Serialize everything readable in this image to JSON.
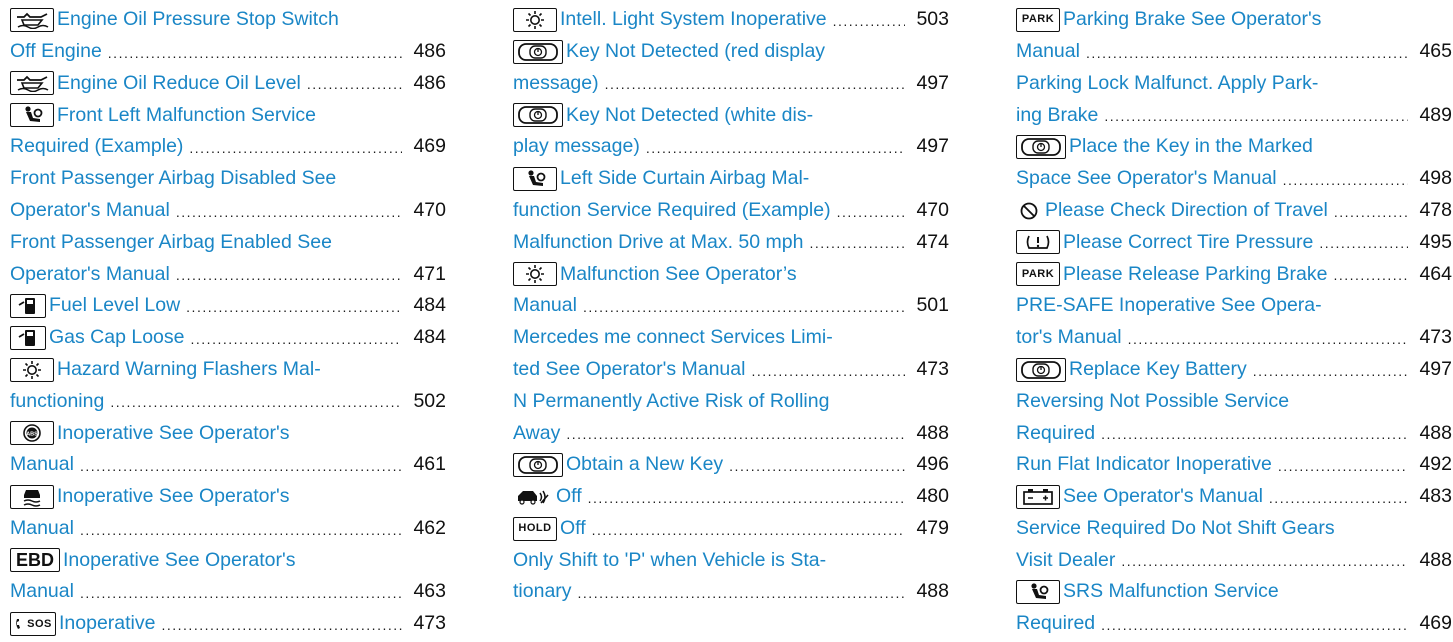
{
  "columns": [
    {
      "lines": [
        {
          "icon": "oil-level-icon",
          "title": "Engine Oil Pressure Stop Switch",
          "page": ""
        },
        {
          "icon": "",
          "title": "Off Engine",
          "page": "486"
        },
        {
          "icon": "oil-level-icon",
          "title": "Engine Oil Reduce Oil Level",
          "page": "486"
        },
        {
          "icon": "airbag-icon",
          "title": "Front Left Malfunction Service",
          "page": ""
        },
        {
          "icon": "",
          "title": "Required (Example)",
          "page": "469"
        },
        {
          "icon": "",
          "title": "Front Passenger Airbag Disabled See",
          "page": ""
        },
        {
          "icon": "",
          "title": "Operator's Manual",
          "page": "470"
        },
        {
          "icon": "",
          "title": "Front Passenger Airbag Enabled See",
          "page": ""
        },
        {
          "icon": "",
          "title": "Operator's Manual",
          "page": "471"
        },
        {
          "icon": "fuel-pump-icon",
          "title": "Fuel Level Low",
          "page": "484"
        },
        {
          "icon": "fuel-pump-icon",
          "title": "Gas Cap Loose",
          "page": "484"
        },
        {
          "icon": "light-bulb-icon",
          "title": " Hazard Warning Flashers Mal-",
          "page": ""
        },
        {
          "icon": "",
          "title": "functioning",
          "page": "502"
        },
        {
          "icon": "abs-icon",
          "title": "Inoperative See Operator's",
          "page": ""
        },
        {
          "icon": "",
          "title": "Manual",
          "page": "461"
        },
        {
          "icon": "stability-control-icon",
          "title": "Inoperative See Operator's",
          "page": ""
        },
        {
          "icon": "",
          "title": "Manual",
          "page": "462"
        },
        {
          "icon": "ebd-icon",
          "title": "Inoperative See Operator's",
          "page": ""
        },
        {
          "icon": "",
          "title": "Manual",
          "page": "463"
        },
        {
          "icon": "sos-icon",
          "title": "Inoperative",
          "page": "473"
        }
      ]
    },
    {
      "lines": [
        {
          "icon": "light-bulb-icon",
          "title": "Intell. Light System Inoperative",
          "page": "503"
        },
        {
          "icon": "key-icon",
          "title": "Key Not Detected  (red display",
          "page": ""
        },
        {
          "icon": "",
          "title": "message)",
          "page": "497"
        },
        {
          "icon": "key-icon",
          "title": "Key Not Detected  (white dis-",
          "page": ""
        },
        {
          "icon": "",
          "title": "play message)",
          "page": "497"
        },
        {
          "icon": "airbag-icon",
          "title": "Left Side Curtain Airbag Mal-",
          "page": ""
        },
        {
          "icon": "",
          "title": "function Service Required (Example)",
          "page": "470"
        },
        {
          "icon": "",
          "title": "Malfunction Drive at Max. 50 mph",
          "page": "474"
        },
        {
          "icon": "light-bulb-icon",
          "title": "Malfunction See Operator’s",
          "page": ""
        },
        {
          "icon": "",
          "title": "Manual",
          "page": "501"
        },
        {
          "icon": "",
          "title": "Mercedes me connect Services Limi-",
          "page": ""
        },
        {
          "icon": "",
          "title": "ted See Operator's Manual",
          "page": "473"
        },
        {
          "icon": "",
          "title": "N Permanently Active Risk of Rolling",
          "page": ""
        },
        {
          "icon": "",
          "title": "Away",
          "page": "488"
        },
        {
          "icon": "key-icon",
          "title": "Obtain a New Key",
          "page": "496"
        },
        {
          "icon": "vehicle-sensor-icon",
          "title": "Off",
          "page": "480"
        },
        {
          "icon": "hold-icon",
          "title": "Off",
          "page": "479"
        },
        {
          "icon": "",
          "title": "Only Shift to 'P' when Vehicle is Sta-",
          "page": ""
        },
        {
          "icon": "",
          "title": "tionary",
          "page": "488"
        }
      ]
    },
    {
      "lines": [
        {
          "icon": "park-icon",
          "title": "Parking Brake See Operator's",
          "page": ""
        },
        {
          "icon": "",
          "title": "Manual",
          "page": "465"
        },
        {
          "icon": "",
          "title": "Parking Lock Malfunct. Apply Park-",
          "page": ""
        },
        {
          "icon": "",
          "title": "ing Brake",
          "page": "489"
        },
        {
          "icon": "key-icon",
          "title": "Place the Key in the Marked",
          "page": ""
        },
        {
          "icon": "",
          "title": "Space See Operator's Manual",
          "page": "498"
        },
        {
          "icon": "no-entry-icon",
          "title": "Please Check Direction of Travel",
          "page": "478"
        },
        {
          "icon": "tire-pressure-icon",
          "title": " Please Correct Tire Pressure",
          "page": "495"
        },
        {
          "icon": "park-icon",
          "title": "Please Release Parking Brake",
          "page": "464"
        },
        {
          "icon": "",
          "title": "PRE-SAFE Inoperative See Opera-",
          "page": ""
        },
        {
          "icon": "",
          "title": "tor's Manual",
          "page": "473"
        },
        {
          "icon": "key-icon",
          "title": "Replace Key Battery",
          "page": "497"
        },
        {
          "icon": "",
          "title": "Reversing Not Possible Service",
          "page": ""
        },
        {
          "icon": "",
          "title": "Required",
          "page": "488"
        },
        {
          "icon": "",
          "title": "Run Flat Indicator Inoperative",
          "page": "492"
        },
        {
          "icon": "battery-icon",
          "title": "See Operator's Manual",
          "page": "483"
        },
        {
          "icon": "",
          "title": "Service Required Do Not Shift Gears",
          "page": ""
        },
        {
          "icon": "",
          "title": "Visit Dealer",
          "page": "488"
        },
        {
          "icon": "airbag-icon",
          "title": "SRS Malfunction Service",
          "page": ""
        },
        {
          "icon": "",
          "title": "Required",
          "page": "469"
        }
      ]
    }
  ],
  "icon_labels": {
    "park": "PARK",
    "hold": "HOLD",
    "ebd": "EBD",
    "sos": "SOS",
    "abs": "ABS"
  }
}
